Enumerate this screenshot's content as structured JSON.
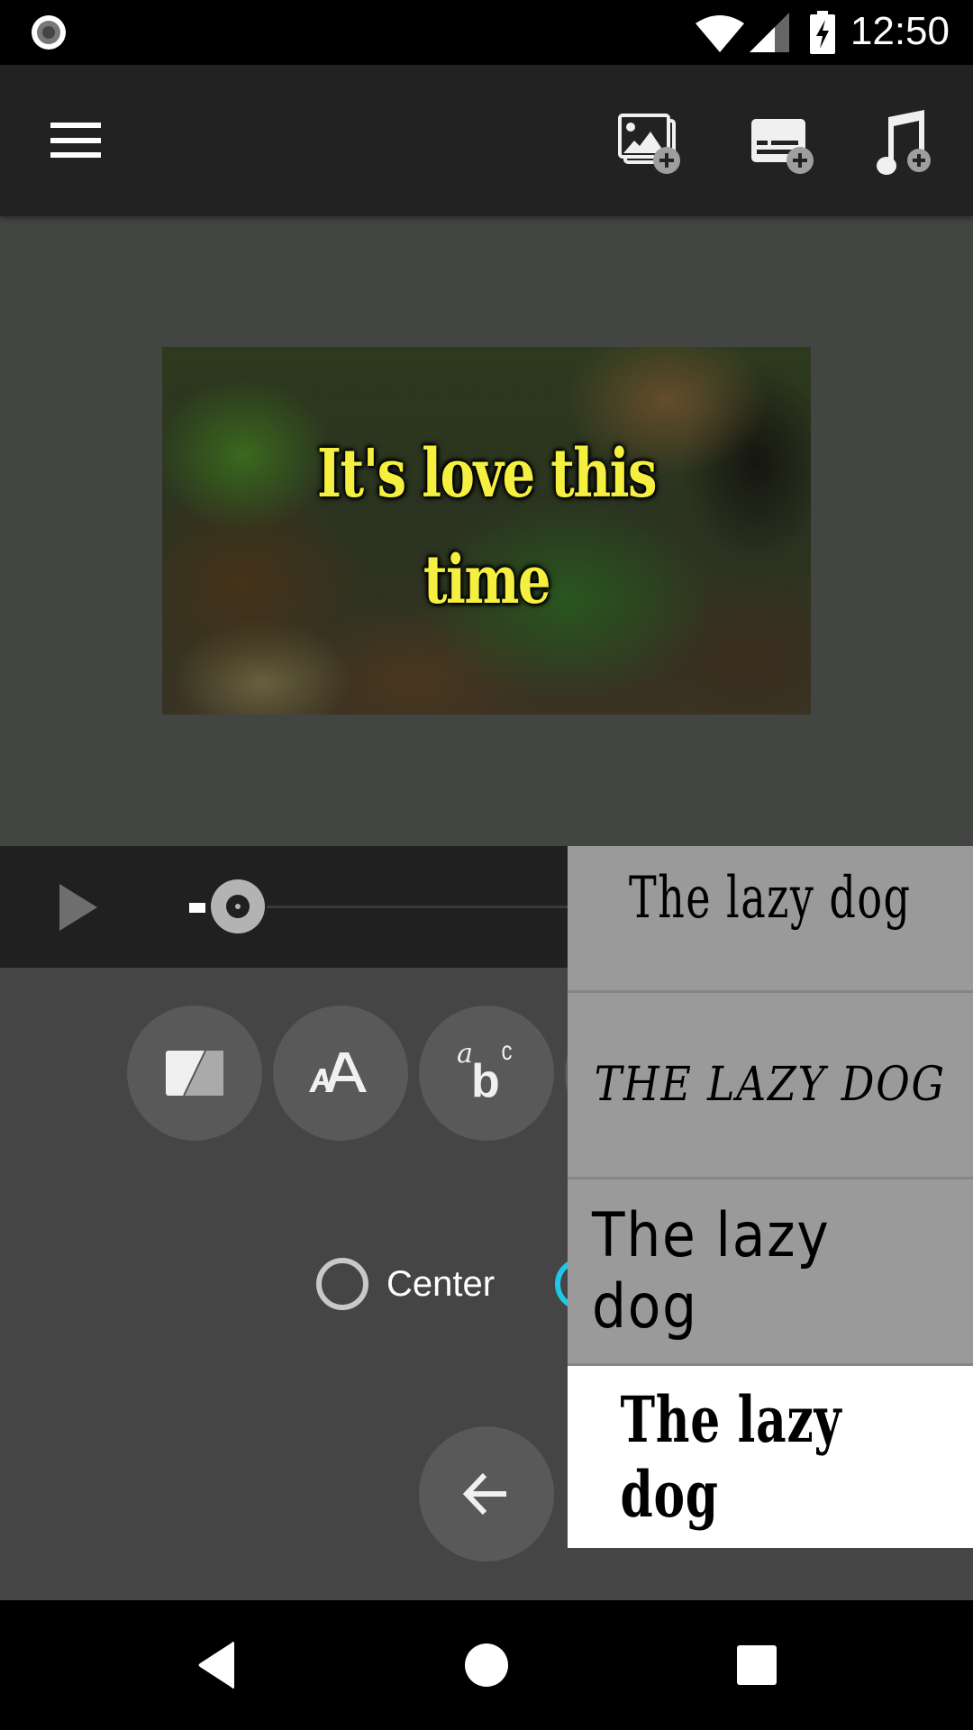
{
  "status_bar": {
    "time": "12:50",
    "left_icon": "record-notification-icon",
    "right_icons": [
      "wifi-icon",
      "cellular-signal-icon",
      "battery-charging-icon"
    ]
  },
  "toolbar": {
    "menu_icon": "hamburger-menu-icon",
    "actions": [
      {
        "name": "add-image-button",
        "icon": "add-image-icon",
        "label": "Add image"
      },
      {
        "name": "add-subtitle-button",
        "icon": "add-subtitle-icon",
        "label": "Add subtitle"
      },
      {
        "name": "add-music-button",
        "icon": "add-music-icon",
        "label": "Add music"
      }
    ]
  },
  "preview": {
    "caption_line1": "It's love this",
    "caption_line2": "time",
    "caption_color": "#f5f040"
  },
  "player": {
    "play_icon": "play-icon",
    "progress": 0
  },
  "tools": {
    "buttons": [
      {
        "name": "color-style-button",
        "icon": "color-split-icon"
      },
      {
        "name": "text-size-button",
        "icon": "text-size-icon"
      },
      {
        "name": "font-button",
        "icon": "font-abc-icon",
        "glyph_a": "a",
        "glyph_b": "b",
        "glyph_c": "c"
      }
    ],
    "alignment": {
      "options": [
        {
          "label": "Center",
          "selected": false
        },
        {
          "label": "",
          "selected": true
        }
      ]
    },
    "back_icon": "arrow-left-icon"
  },
  "font_panel": {
    "items": [
      {
        "sample": "The lazy dog",
        "selected": false
      },
      {
        "sample": "THE LAZY DOG",
        "selected": false
      },
      {
        "sample": "The lazy dog",
        "selected": false
      },
      {
        "sample": "The lazy dog",
        "selected": true
      }
    ]
  },
  "colors": {
    "accent_radio": "#1fc8e8",
    "panel_bg": "#9a9a9a",
    "toolbar_bg": "#222222"
  },
  "nav_bar": {
    "buttons": [
      "back-icon",
      "home-icon",
      "recents-icon"
    ]
  }
}
